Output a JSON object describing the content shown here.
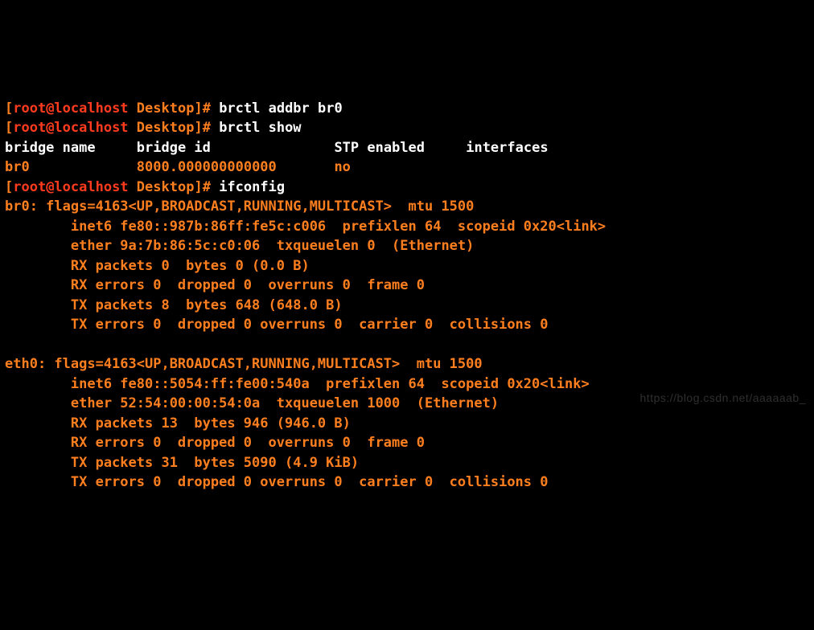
{
  "prompt": {
    "open_bracket": "[",
    "user_host": "root@localhost",
    "space": " ",
    "cwd": "Desktop",
    "close": "]#"
  },
  "cmds": {
    "c1": "brctl addbr br0",
    "c2": "brctl show",
    "c3": "ifconfig"
  },
  "brctl_header": {
    "col1": "bridge name",
    "col2": "bridge id",
    "col3": "STP enabled",
    "col4": "interfaces"
  },
  "brctl_row": {
    "name": "br0",
    "id": "8000.000000000000",
    "stp": "no",
    "ifaces": ""
  },
  "ifconfig": {
    "br0": {
      "head": "br0: flags=4163<UP,BROADCAST,RUNNING,MULTICAST>  mtu 1500",
      "l1": "        inet6 fe80::987b:86ff:fe5c:c006  prefixlen 64  scopeid 0x20<link>",
      "l2": "        ether 9a:7b:86:5c:c0:06  txqueuelen 0  (Ethernet)",
      "l3": "        RX packets 0  bytes 0 (0.0 B)",
      "l4": "        RX errors 0  dropped 0  overruns 0  frame 0",
      "l5": "        TX packets 8  bytes 648 (648.0 B)",
      "l6": "        TX errors 0  dropped 0 overruns 0  carrier 0  collisions 0"
    },
    "eth0": {
      "head": "eth0: flags=4163<UP,BROADCAST,RUNNING,MULTICAST>  mtu 1500",
      "l1": "        inet6 fe80::5054:ff:fe00:540a  prefixlen 64  scopeid 0x20<link>",
      "l2": "        ether 52:54:00:00:54:0a  txqueuelen 1000  (Ethernet)",
      "l3": "        RX packets 13  bytes 946 (946.0 B)",
      "l4": "        RX errors 0  dropped 0  overruns 0  frame 0",
      "l5": "        TX packets 31  bytes 5090 (4.9 KiB)",
      "l6": "        TX errors 0  dropped 0 overruns 0  carrier 0  collisions 0"
    }
  },
  "watermark": "https://blog.csdn.net/aaaaaab_"
}
